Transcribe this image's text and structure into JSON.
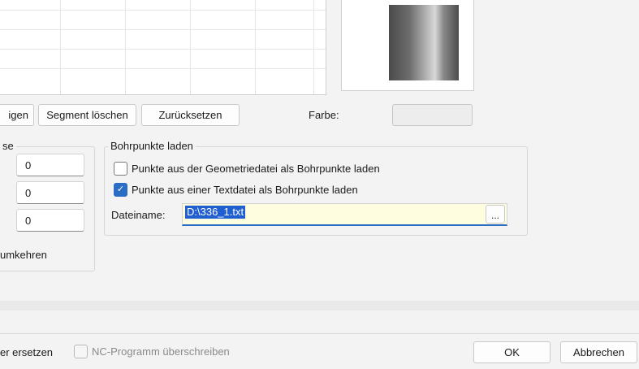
{
  "toolbar": {
    "show_label_partial": "igen",
    "delete_segment_label": "Segment löschen",
    "reset_label": "Zurücksetzen"
  },
  "color": {
    "label": "Farbe:",
    "swatch_color": "#ededed"
  },
  "left_group": {
    "title_partial": "se",
    "values": [
      "0",
      "0",
      "0"
    ],
    "reverse_label_partial": "umkehren"
  },
  "drill_points": {
    "title": "Bohrpunkte laden",
    "from_geometry_label": "Punkte aus der Geometriedatei als Bohrpunkte laden",
    "from_geometry_checked": false,
    "from_textfile_label": "Punkte aus einer Textdatei als Bohrpunkte laden",
    "from_textfile_checked": true,
    "filename_label": "Dateiname:",
    "filename_value": "D:\\336_1.txt",
    "browse_label": "..."
  },
  "footer": {
    "replace_label_partial": "er ersetzen",
    "overwrite_nc_label": "NC-Programm überschreiben",
    "ok_label": "OK",
    "cancel_label": "Abbrechen"
  },
  "colors": {
    "accent": "#2b6cc4",
    "filename_bg": "#fffde0"
  }
}
